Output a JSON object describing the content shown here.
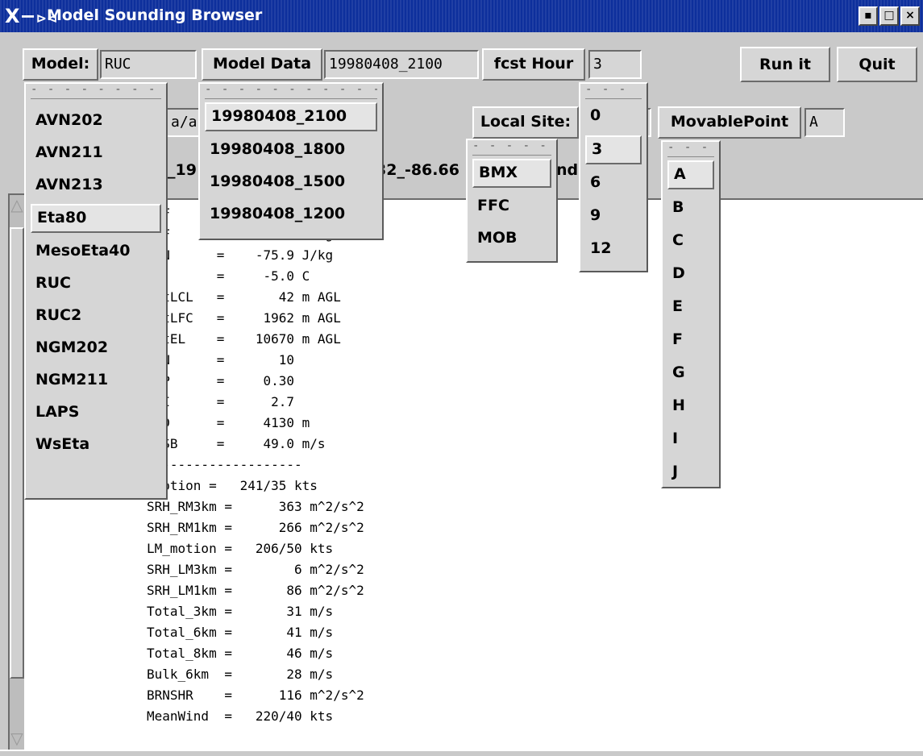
{
  "window": {
    "title": "Model Sounding Browser",
    "controls": [
      "▪",
      "□",
      "×"
    ]
  },
  "toolbar": {
    "model_label": "Model:",
    "model_value": "RUC",
    "model_data_label": "Model Data",
    "model_data_value": "19980408_2100",
    "fcst_hour_label": "fcst Hour",
    "fcst_hour_value": "3",
    "run_label": "Run it",
    "quit_label": "Quit"
  },
  "row2": {
    "path_fragment": "a/a",
    "local_site_label": "Local Site:",
    "movable_point_label": "MovablePoint",
    "movable_point_value": "A"
  },
  "row3": {
    "file_fragment_left": "_19",
    "file_fragment_mid": "32_-86.66",
    "file_fragment_right": "nd"
  },
  "menus": {
    "model": {
      "tear": "- - - - - - - -",
      "items": [
        "AVN202",
        "AVN211",
        "AVN213",
        "Eta80",
        "MesoEta40",
        "RUC",
        "RUC2",
        "NGM202",
        "NGM211",
        "LAPS",
        "WsEta"
      ],
      "selected": "Eta80"
    },
    "model_data": {
      "tear": "- - - - - - - - - - -",
      "items": [
        "19980408_2100",
        "19980408_1800",
        "19980408_1500",
        "19980408_1200"
      ],
      "selected": "19980408_2100"
    },
    "local_site": {
      "tear": "- - - - -",
      "items": [
        "BMX",
        "FFC",
        "MOB"
      ],
      "selected": "BMX"
    },
    "fcst_hour": {
      "tear": "- - -",
      "items": [
        "0",
        "3",
        "6",
        "9",
        "12"
      ],
      "selected": "3"
    },
    "movable_point": {
      "tear": "- - -",
      "items": [
        "A",
        "B",
        "C",
        "D",
        "E",
        "F",
        "G",
        "H",
        "I",
        "J"
      ],
      "selected": "A"
    }
  },
  "output_lines": [
    "CAF                  /kg",
    "CAF                  /kg",
    "CIN      =    -75.9 J/kg",
    "LI       =     -5.0 C",
    "hgtLCL   =       42 m AGL",
    "hgtLFC   =     1962 m AGL",
    "hgtEL    =    10670 m AGL",
    "BRN      =       10",
    "VGP      =     0.30",
    "EHI      =      2.7",
    "WCD      =     4130 m",
    "axSB     =     49.0 m/s",
    "  ------------------",
    "_motion =   241/35 kts",
    "SRH_RM3km =      363 m^2/s^2",
    "SRH_RM1km =      266 m^2/s^2",
    "LM_motion =   206/50 kts",
    "SRH_LM3km =        6 m^2/s^2",
    "SRH_LM1km =       86 m^2/s^2",
    "Total_3km =       31 m/s",
    "Total_6km =       41 m/s",
    "Total_8km =       46 m/s",
    "Bulk_6km  =       28 m/s",
    "BRNSHR    =      116 m^2/s^2",
    "MeanWind  =   220/40 kts"
  ]
}
